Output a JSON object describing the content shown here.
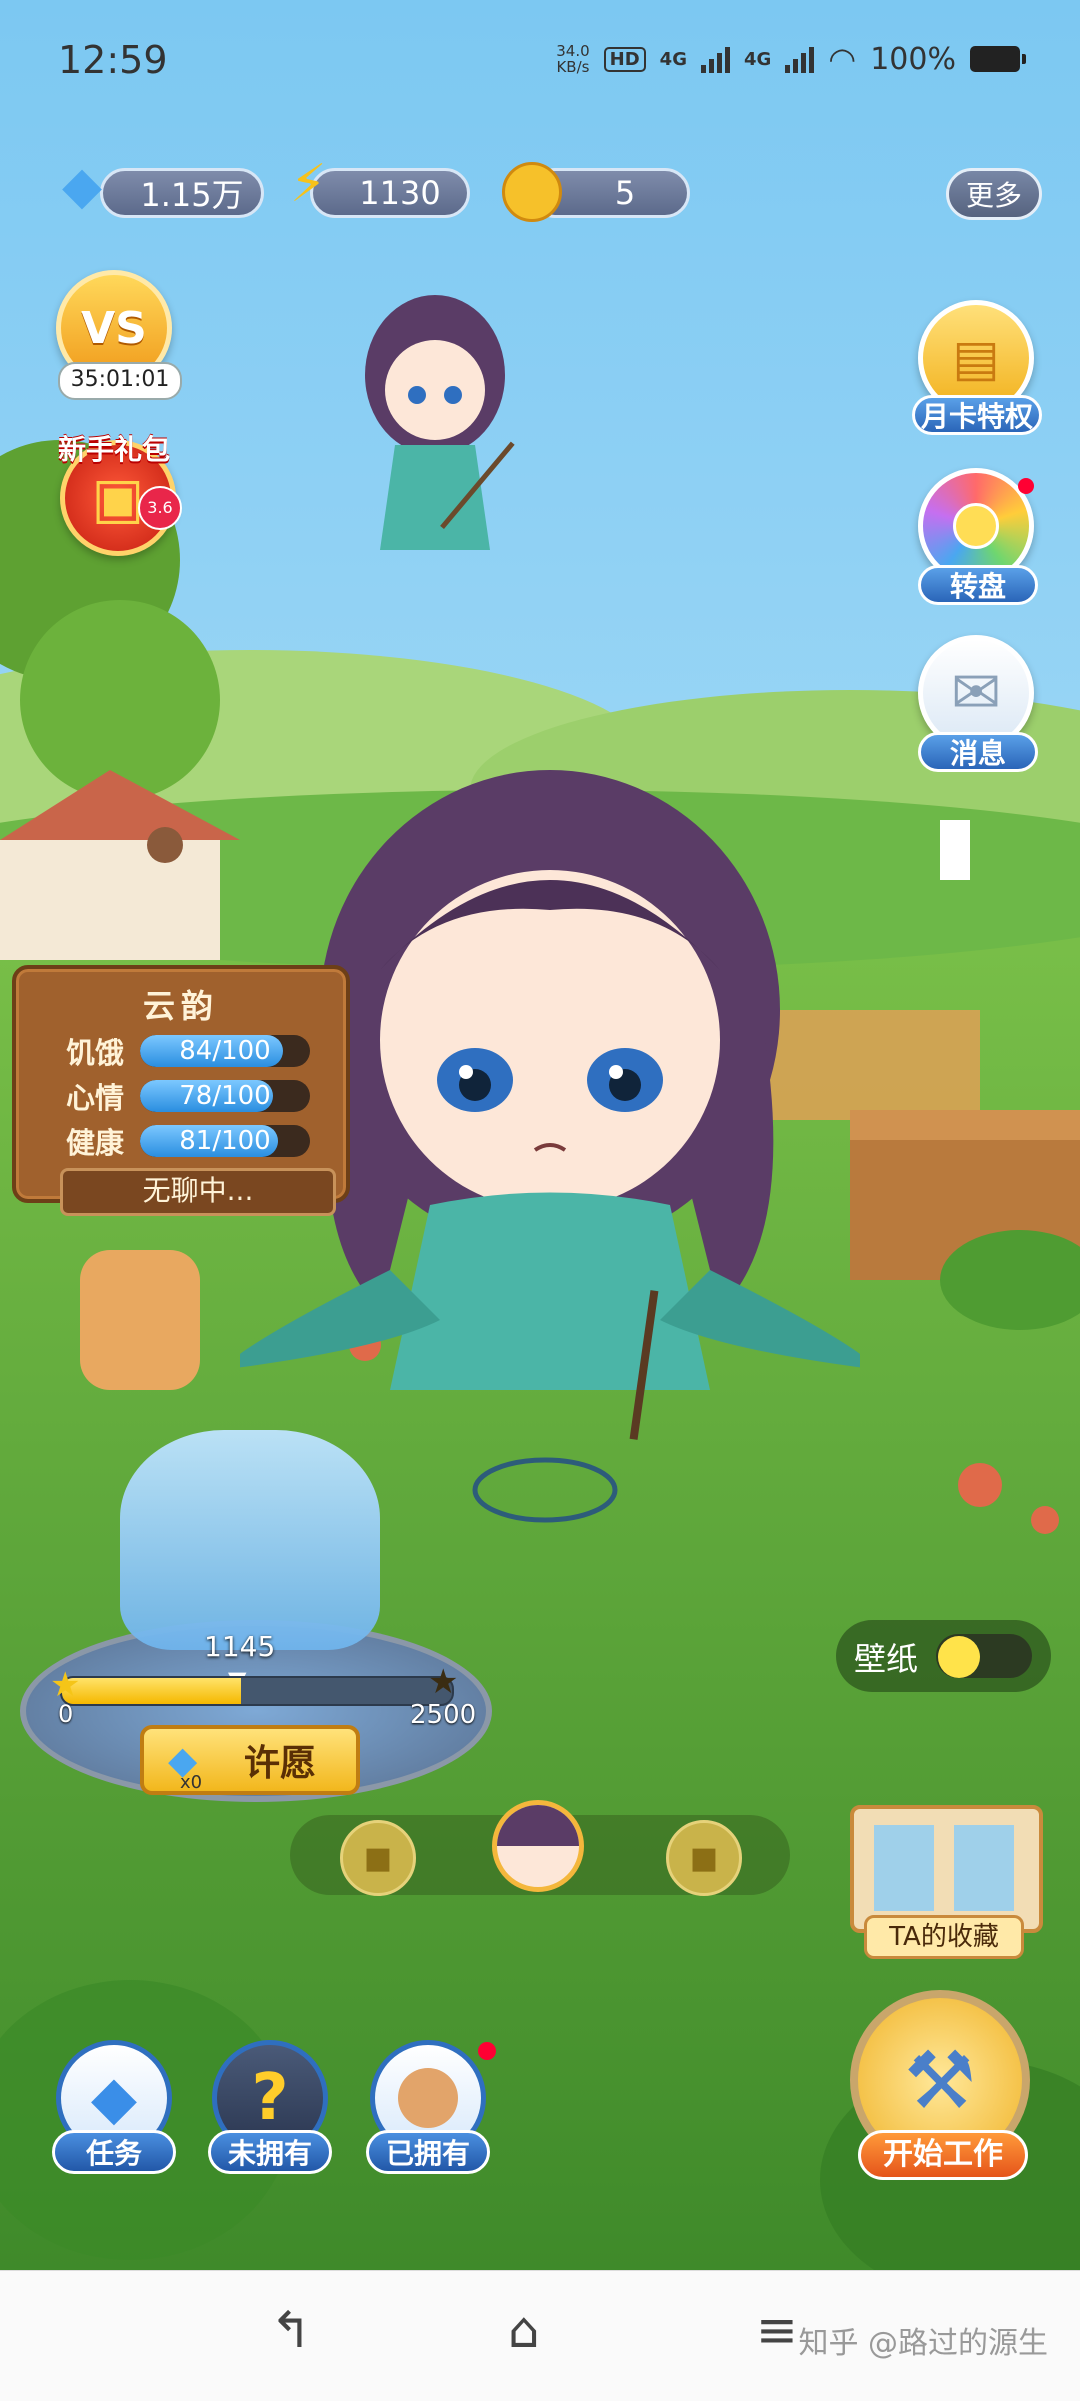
{
  "status_bar": {
    "time": "12:59",
    "net_speed": "34.0\nKB/s",
    "hd": "HD",
    "net1": "4G",
    "net2": "4G",
    "battery": "100%"
  },
  "resources": {
    "gems": "1.15万",
    "energy": "1130",
    "coins": "5",
    "more": "更多"
  },
  "left_panel": {
    "pvp_timer": "35:01:01",
    "newbie_gift": "新手礼包",
    "gift_badge": "3.6"
  },
  "right_panel": {
    "monthly_card": "月卡特权",
    "wheel": "转盘",
    "messages": "消息",
    "wallpaper": "壁纸",
    "collection": "TA的收藏",
    "start_work": "开始工作"
  },
  "character": {
    "name": "云韵",
    "stats": [
      {
        "label": "饥饿",
        "value": "84/100",
        "fill": 0.84
      },
      {
        "label": "心情",
        "value": "78/100",
        "fill": 0.78
      },
      {
        "label": "健康",
        "value": "81/100",
        "fill": 0.81
      }
    ],
    "mood": "无聊中..."
  },
  "wish": {
    "min": "0",
    "max": "2500",
    "current": "1145",
    "progress": 0.458,
    "gem_count": "x0",
    "button": "许愿"
  },
  "bottom_nav": {
    "tasks": "任务",
    "unowned": "未拥有",
    "owned": "已拥有"
  },
  "system_nav": {
    "watermark": "知乎 @路过的源生"
  },
  "colors": {
    "sky": "#8fd3f4",
    "grass": "#5fae3b",
    "accent_blue": "#2f6fbf"
  }
}
